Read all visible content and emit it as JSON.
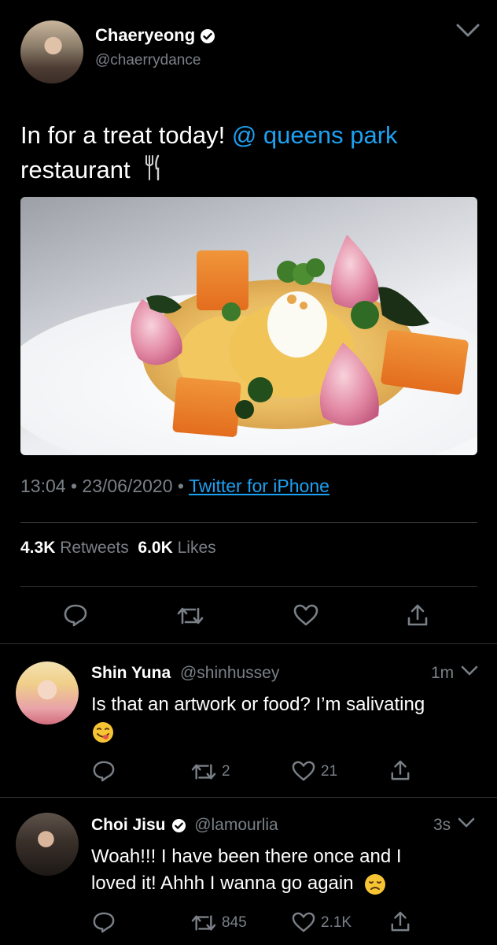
{
  "main_tweet": {
    "name": "Chaeryeong",
    "handle": "@chaerrydance",
    "text_before": "In for a treat today! ",
    "mention": "@ queens park",
    "text_after": "restaurant",
    "time": "13:04",
    "date": "23/06/2020",
    "source": "Twitter for iPhone",
    "retweets_count": "4.3K",
    "retweets_label": "Retweets",
    "likes_count": "6.0K",
    "likes_label": "Likes"
  },
  "replies": [
    {
      "name": "Shin Yuna",
      "handle": "@shinhussey",
      "time": "1m",
      "text": "Is that an artwork or food? I’m salivating",
      "retweets": "2",
      "likes": "21"
    },
    {
      "name": "Choi Jisu",
      "handle": "@lamourlia",
      "time": "3s",
      "text": "Woah!!! I have been there once and I loved it! Ahhh I wanna go again",
      "retweets": "845",
      "likes": "2.1K"
    }
  ],
  "colors": {
    "background": "#000000",
    "accent": "#1da1f2",
    "muted": "#7a8087",
    "divider": "#2f3336"
  },
  "icons": [
    "verified-icon",
    "chevron-down-icon",
    "fork-knife-icon",
    "reply-icon",
    "retweet-icon",
    "like-icon",
    "share-icon",
    "yum-emoji",
    "disappointed-emoji"
  ]
}
